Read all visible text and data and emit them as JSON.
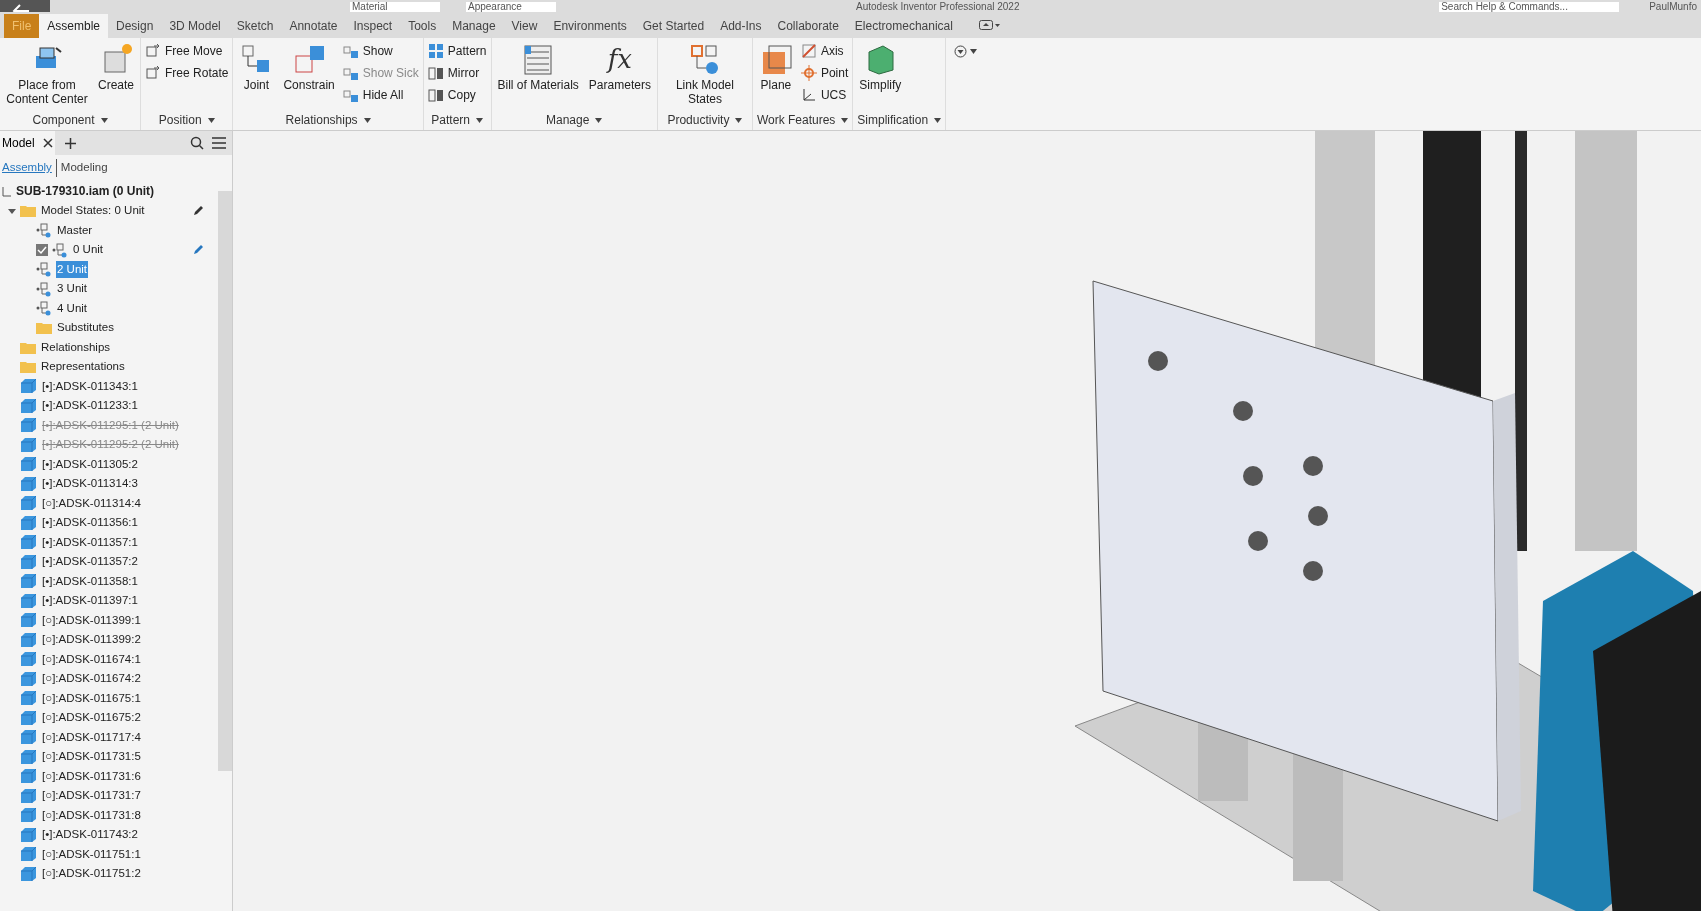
{
  "title_bar": {
    "material": "Material",
    "appearance": "Appearance",
    "title": "Autodesk Inventor Professional 2022",
    "search": {
      "placeholder": "Search Help & Commands..."
    },
    "user": "PaulMunfo"
  },
  "tabs": [
    {
      "label": "File",
      "selected": false,
      "kind": "file"
    },
    {
      "label": "Assemble",
      "selected": true,
      "kind": "tab"
    },
    {
      "label": "Design",
      "selected": false,
      "kind": "tab"
    },
    {
      "label": "3D Model",
      "selected": false,
      "kind": "tab"
    },
    {
      "label": "Sketch",
      "selected": false,
      "kind": "tab"
    },
    {
      "label": "Annotate",
      "selected": false,
      "kind": "tab"
    },
    {
      "label": "Inspect",
      "selected": false,
      "kind": "tab"
    },
    {
      "label": "Tools",
      "selected": false,
      "kind": "tab"
    },
    {
      "label": "Manage",
      "selected": false,
      "kind": "tab"
    },
    {
      "label": "View",
      "selected": false,
      "kind": "tab"
    },
    {
      "label": "Environments",
      "selected": false,
      "kind": "tab"
    },
    {
      "label": "Get Started",
      "selected": false,
      "kind": "tab"
    },
    {
      "label": "Add-Ins",
      "selected": false,
      "kind": "tab"
    },
    {
      "label": "Collaborate",
      "selected": false,
      "kind": "tab"
    },
    {
      "label": "Electromechanical",
      "selected": false,
      "kind": "tab"
    }
  ],
  "ribbon": [
    {
      "title": "Component",
      "large": [
        {
          "label": "Place from Content Center"
        },
        {
          "label": "Create"
        }
      ]
    },
    {
      "title": "Position",
      "small": [
        {
          "label": "Free Move",
          "disabled": false
        },
        {
          "label": "Free Rotate",
          "disabled": false
        }
      ]
    },
    {
      "title": "Relationships",
      "large": [
        {
          "label": "Joint"
        },
        {
          "label": "Constrain"
        }
      ],
      "small": [
        {
          "label": "Show",
          "disabled": false
        },
        {
          "label": "Show Sick",
          "disabled": true
        },
        {
          "label": "Hide All",
          "disabled": false
        }
      ]
    },
    {
      "title": "Pattern",
      "small": [
        {
          "label": "Pattern",
          "disabled": false
        },
        {
          "label": "Mirror",
          "disabled": false
        },
        {
          "label": "Copy",
          "disabled": false
        }
      ]
    },
    {
      "title": "Manage",
      "large": [
        {
          "label": "Bill of Materials"
        },
        {
          "label": "Parameters",
          "glyph": "fx"
        }
      ]
    },
    {
      "title": "Productivity",
      "large": [
        {
          "label": "Link Model States"
        }
      ]
    },
    {
      "title": "Work Features",
      "large": [
        {
          "label": "Plane"
        }
      ],
      "small": [
        {
          "label": "Axis",
          "disabled": false
        },
        {
          "label": "Point",
          "disabled": false
        },
        {
          "label": "UCS",
          "disabled": false
        }
      ]
    },
    {
      "title": "Simplification",
      "large": [
        {
          "label": "Simplify"
        }
      ]
    }
  ],
  "browser": {
    "tab": "Model",
    "view_tabs": [
      {
        "label": "Assembly",
        "selected": true
      },
      {
        "label": "Modeling",
        "selected": false
      }
    ],
    "root": "SUB-179310.iam (0 Unit)",
    "items": [
      {
        "label": "Model States: 0 Unit",
        "kind": "folder",
        "expanded": true,
        "children": [
          {
            "label": "Master",
            "kind": "state",
            "active": false,
            "selected": false
          },
          {
            "label": "0 Unit",
            "kind": "state",
            "active": true,
            "selected": false
          },
          {
            "label": "2 Unit",
            "kind": "state",
            "active": false,
            "selected": true
          },
          {
            "label": "3 Unit",
            "kind": "state",
            "active": false,
            "selected": false
          },
          {
            "label": "4 Unit",
            "kind": "state",
            "active": false,
            "selected": false
          },
          {
            "label": "Substitutes",
            "kind": "folder"
          }
        ]
      },
      {
        "label": "Relationships",
        "kind": "folder"
      },
      {
        "label": "Representations",
        "kind": "folder"
      },
      {
        "label": "[•]:ADSK-011343:1",
        "kind": "part",
        "suppressed": false
      },
      {
        "label": "[•]:ADSK-011233:1",
        "kind": "part",
        "suppressed": false
      },
      {
        "label": "[•]:ADSK-011295:1 (2 Unit)",
        "kind": "part",
        "suppressed": true
      },
      {
        "label": "[•]:ADSK-011295:2 (2 Unit)",
        "kind": "part",
        "suppressed": true
      },
      {
        "label": "[•]:ADSK-011305:2",
        "kind": "part",
        "suppressed": false
      },
      {
        "label": "[•]:ADSK-011314:3",
        "kind": "part",
        "suppressed": false
      },
      {
        "label": "[○]:ADSK-011314:4",
        "kind": "part",
        "suppressed": false
      },
      {
        "label": "[•]:ADSK-011356:1",
        "kind": "part",
        "suppressed": false
      },
      {
        "label": "[•]:ADSK-011357:1",
        "kind": "part",
        "suppressed": false
      },
      {
        "label": "[•]:ADSK-011357:2",
        "kind": "part",
        "suppressed": false
      },
      {
        "label": "[•]:ADSK-011358:1",
        "kind": "part",
        "suppressed": false
      },
      {
        "label": "[•]:ADSK-011397:1",
        "kind": "part",
        "suppressed": false
      },
      {
        "label": "[○]:ADSK-011399:1",
        "kind": "part",
        "suppressed": false
      },
      {
        "label": "[○]:ADSK-011399:2",
        "kind": "part",
        "suppressed": false
      },
      {
        "label": "[○]:ADSK-011674:1",
        "kind": "part",
        "suppressed": false
      },
      {
        "label": "[○]:ADSK-011674:2",
        "kind": "part",
        "suppressed": false
      },
      {
        "label": "[○]:ADSK-011675:1",
        "kind": "part",
        "suppressed": false
      },
      {
        "label": "[○]:ADSK-011675:2",
        "kind": "part",
        "suppressed": false
      },
      {
        "label": "[○]:ADSK-011717:4",
        "kind": "part",
        "suppressed": false
      },
      {
        "label": "[○]:ADSK-011731:5",
        "kind": "part",
        "suppressed": false
      },
      {
        "label": "[○]:ADSK-011731:6",
        "kind": "part",
        "suppressed": false
      },
      {
        "label": "[○]:ADSK-011731:7",
        "kind": "part",
        "suppressed": false
      },
      {
        "label": "[○]:ADSK-011731:8",
        "kind": "part",
        "suppressed": false
      },
      {
        "label": "[•]:ADSK-011743:2",
        "kind": "part",
        "suppressed": false
      },
      {
        "label": "[○]:ADSK-011751:1",
        "kind": "part",
        "suppressed": false
      },
      {
        "label": "[○]:ADSK-011751:2",
        "kind": "part",
        "suppressed": false
      }
    ]
  }
}
